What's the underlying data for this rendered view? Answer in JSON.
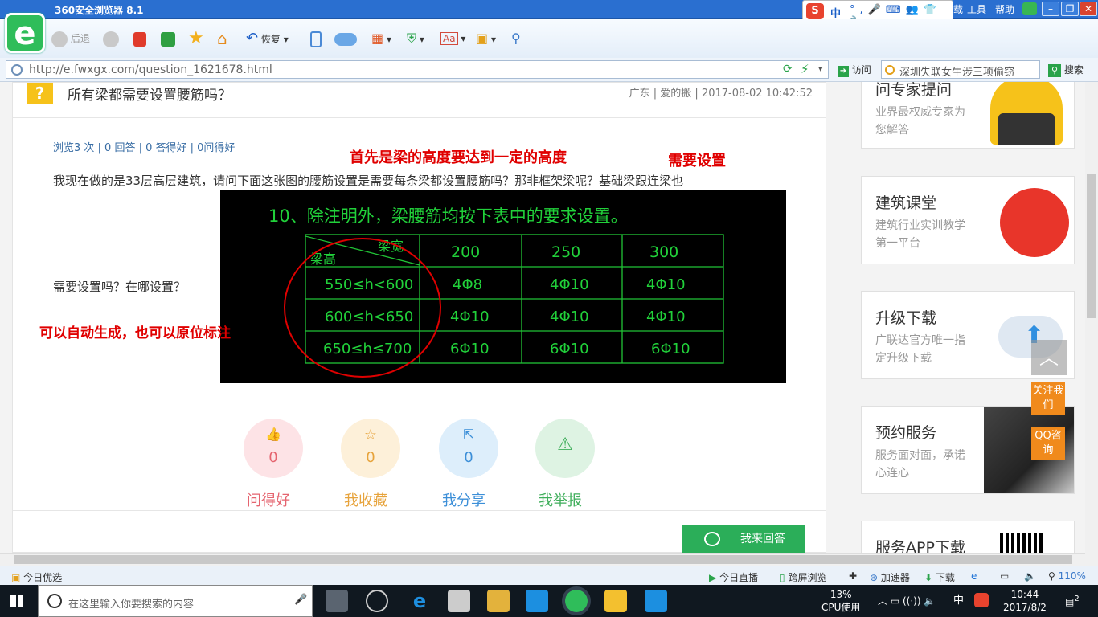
{
  "browser": {
    "title": "360安全浏览器 8.1",
    "menu": [
      "工具",
      "帮助"
    ],
    "back_label": "后退",
    "restore_label": "恢复",
    "url": "http://e.fwxgx.com/question_1621678.html",
    "visit_label": "访问",
    "search_value": "深圳失联女生涉三项偷窃",
    "search_button": "搜索",
    "ime_label": "中"
  },
  "question": {
    "title": "所有梁都需要设置腰筋吗？",
    "meta": "广东 | 爱的搬 | 2017-08-02 10:42:52",
    "stats": "浏览3 次 | 0 回答 | 0 答得好 | 0问得好",
    "text_line1": "我现在做的是33层高层建筑，请问下面这张图的腰筋设置是需要每条梁都设置腰筋吗？那非框架梁呢？基础梁跟连梁也",
    "text_line2": "需要设置吗？在哪设置？"
  },
  "annotations": {
    "top": "首先是梁的高度要达到一定的高度",
    "right": "需要设置",
    "left": "可以自动生成，也可以原位标注"
  },
  "cad": {
    "heading": "10、除注明外，梁腰筋均按下表中的要求设置。",
    "corner_top": "梁宽",
    "corner_bottom": "梁高",
    "cols": [
      "200",
      "250",
      "300"
    ],
    "rows": [
      {
        "h": "550≤h<600",
        "v": [
          "4Φ8",
          "4Φ10",
          "4Φ10"
        ]
      },
      {
        "h": "600≤h<650",
        "v": [
          "4Φ10",
          "4Φ10",
          "4Φ10"
        ]
      },
      {
        "h": "650≤h≤700",
        "v": [
          "6Φ10",
          "6Φ10",
          "6Φ10"
        ]
      }
    ]
  },
  "actions": [
    {
      "label": "问得好",
      "count": "0",
      "color": "#e5646f",
      "bg": "#fde3e6"
    },
    {
      "label": "我收藏",
      "count": "0",
      "color": "#e7a33b",
      "bg": "#fdf0d9"
    },
    {
      "label": "我分享",
      "count": "0",
      "color": "#3c8fd8",
      "bg": "#ddeefb"
    },
    {
      "label": "我举报",
      "count": "",
      "color": "#3fae5b",
      "bg": "#def3e3"
    }
  ],
  "answer_button": "我来回答",
  "sidebar": [
    {
      "title": "问专家提问",
      "sub": "业界最权威专家为您解答"
    },
    {
      "title": "建筑课堂",
      "sub": "建筑行业实训教学第一平台"
    },
    {
      "title": "升级下载",
      "sub": "广联达官方唯一指定升级下载"
    },
    {
      "title": "预约服务",
      "sub": "服务面对面，承诺心连心"
    },
    {
      "title": "服务APP下载",
      "sub": ""
    }
  ],
  "float_buttons": [
    "关注我们",
    "QQ咨询"
  ],
  "statusbar": {
    "left": "今日优选",
    "live": "今日直播",
    "cross": "跨屏浏览",
    "accel": "加速器",
    "download": "下载",
    "zoom": "110%"
  },
  "taskbar": {
    "search_placeholder": "在这里输入你要搜索的内容",
    "cpu_percent": "13%",
    "cpu_label": "CPU使用",
    "ime": "中",
    "time": "10:44",
    "date": "2017/8/2",
    "notifications": "2"
  }
}
